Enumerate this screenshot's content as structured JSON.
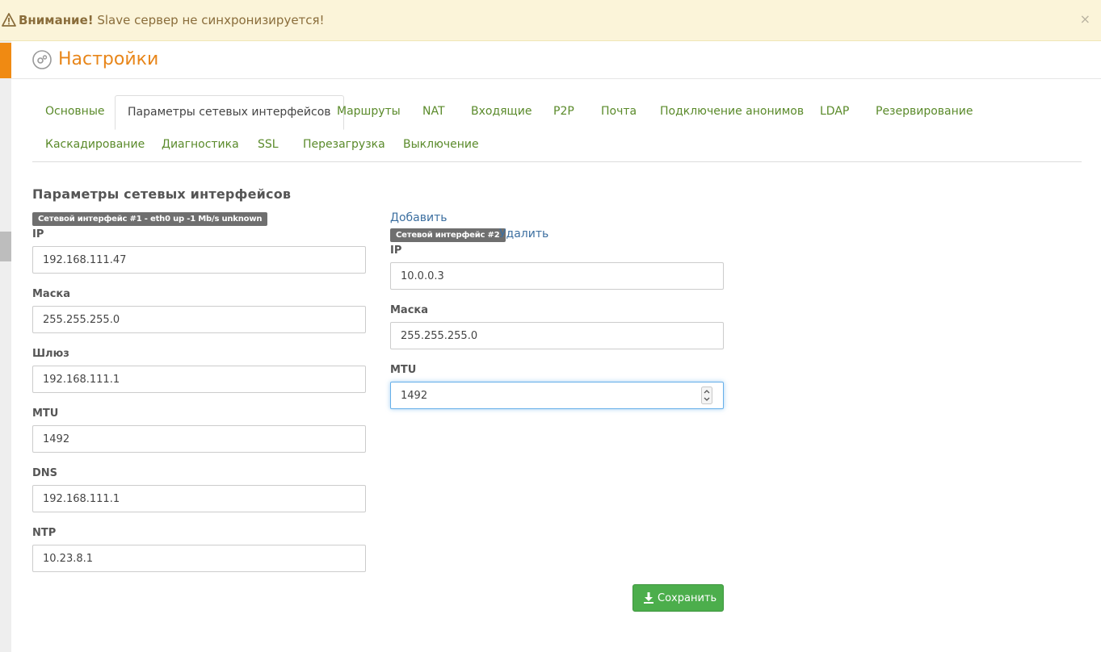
{
  "alert": {
    "strong": "Внимание!",
    "message": " Slave сервер не синхронизируется!",
    "close": "×"
  },
  "header": {
    "title": "Настройки"
  },
  "tabs": [
    {
      "label": "Основные",
      "active": false
    },
    {
      "label": "Параметры сетевых интерфейсов",
      "active": true
    },
    {
      "label": "Маршруты",
      "active": false
    },
    {
      "label": "NAT",
      "active": false
    },
    {
      "label": "Входящие",
      "active": false
    },
    {
      "label": "P2P",
      "active": false
    },
    {
      "label": "Почта",
      "active": false
    },
    {
      "label": "Подключение анонимов",
      "active": false
    },
    {
      "label": "LDAP",
      "active": false
    },
    {
      "label": "Резервирование",
      "active": false
    },
    {
      "label": "Каскадирование",
      "active": false
    },
    {
      "label": "Диагностика",
      "active": false
    },
    {
      "label": "SSL",
      "active": false
    },
    {
      "label": "Перезагрузка",
      "active": false
    },
    {
      "label": "Выключение",
      "active": false
    }
  ],
  "section": {
    "title": "Параметры сетевых интерфейсов"
  },
  "interface1": {
    "badge": "Сетевой интерфейс #1 - eth0 up -1 Mb/s unknown",
    "fields": [
      {
        "label": "IP",
        "value": "192.168.111.47"
      },
      {
        "label": "Маска",
        "value": "255.255.255.0"
      },
      {
        "label": "Шлюз",
        "value": "192.168.111.1"
      },
      {
        "label": "MTU",
        "value": "1492"
      },
      {
        "label": "DNS",
        "value": "192.168.111.1"
      },
      {
        "label": "NTP",
        "value": "10.23.8.1"
      }
    ]
  },
  "interface2": {
    "add_link": "Добавить",
    "badge": "Сетевой интерфейс #2",
    "delete_link": "Удалить",
    "fields": [
      {
        "label": "IP",
        "value": "10.0.0.3"
      },
      {
        "label": "Маска",
        "value": "255.255.255.0"
      },
      {
        "label": "MTU",
        "value": "1492"
      }
    ]
  },
  "actions": {
    "save_label": "Сохранить"
  },
  "colors": {
    "accent": "#e8861a",
    "tab_link": "#5a8a2a",
    "save": "#4cae4c",
    "alert_bg": "#fbf4d9"
  }
}
